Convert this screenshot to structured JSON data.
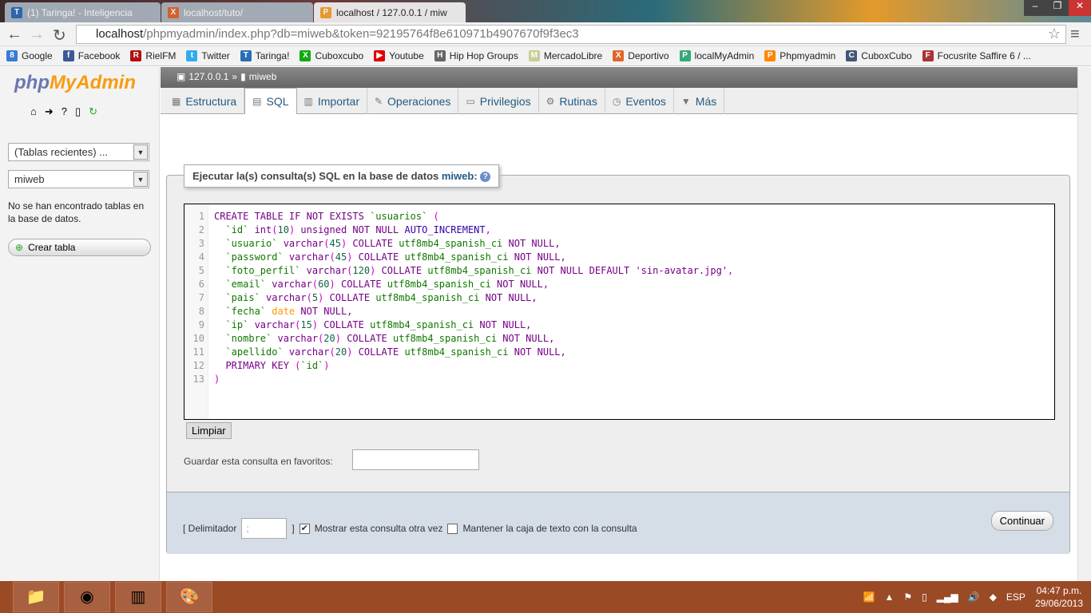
{
  "browser": {
    "tabs": [
      {
        "label": "(1) Taringa! - Inteligencia",
        "icon": "T",
        "color": "#2b6db6"
      },
      {
        "label": "localhost/tuto/",
        "icon": "X",
        "color": "#e0662a"
      },
      {
        "label": "localhost / 127.0.0.1 / miw",
        "icon": "P",
        "color": "#f0a030"
      }
    ],
    "url_host": "localhost",
    "url_path": "/phpmyadmin/index.php?db=miweb&token=92195764f8e610971b4907670f9f3ec3",
    "bookmarks": [
      {
        "label": "Google",
        "icon": "8",
        "color": "#3a7bd5"
      },
      {
        "label": "Facebook",
        "icon": "f",
        "color": "#3b5998"
      },
      {
        "label": "RielFM",
        "icon": "R",
        "color": "#b01010"
      },
      {
        "label": "Twitter",
        "icon": "t",
        "color": "#33aaee"
      },
      {
        "label": "Taringa!",
        "icon": "T",
        "color": "#2b6db6"
      },
      {
        "label": "Cuboxcubo",
        "icon": "X",
        "color": "#1a1"
      },
      {
        "label": "Youtube",
        "icon": "▶",
        "color": "#d00"
      },
      {
        "label": "Hip Hop Groups",
        "icon": "H",
        "color": "#666"
      },
      {
        "label": "MercadoLibre",
        "icon": "M",
        "color": "#cc9"
      },
      {
        "label": "Deportivo",
        "icon": "X",
        "color": "#e0662a"
      },
      {
        "label": "localMyAdmin",
        "icon": "P",
        "color": "#3a7"
      },
      {
        "label": "Phpmyadmin",
        "icon": "P",
        "color": "#f80"
      },
      {
        "label": "CuboxCubo",
        "icon": "C",
        "color": "#457"
      },
      {
        "label": "Focusrite Saffire 6 / ...",
        "icon": "F",
        "color": "#a33"
      }
    ]
  },
  "sidebar": {
    "logo_a": "php",
    "logo_b": "MyAdmin",
    "recent": "(Tablas recientes) ...",
    "db": "miweb",
    "no_tables": "No se han encontrado tablas en la base de datos.",
    "create": "Crear tabla"
  },
  "breadcrumb": {
    "server": "127.0.0.1",
    "sep": "»",
    "db": "miweb"
  },
  "tabs": [
    {
      "label": "Estructura",
      "icon": "▦"
    },
    {
      "label": "SQL",
      "icon": "▤"
    },
    {
      "label": "Importar",
      "icon": "▥"
    },
    {
      "label": "Operaciones",
      "icon": "✎"
    },
    {
      "label": "Privilegios",
      "icon": "▭"
    },
    {
      "label": "Rutinas",
      "icon": "⚙"
    },
    {
      "label": "Eventos",
      "icon": "◷"
    },
    {
      "label": "Más",
      "icon": "▼"
    }
  ],
  "query": {
    "legend": "Ejecutar la(s) consulta(s) SQL en la base de datos",
    "db": "miweb:",
    "lines": [
      [
        [
          "CREATE TABLE IF NOT EXISTS ",
          "kw"
        ],
        [
          "`usuarios`",
          "nm"
        ],
        [
          " (",
          "pn"
        ]
      ],
      [
        [
          "  `id`",
          "nm"
        ],
        [
          " int",
          "df"
        ],
        [
          "(",
          "pn"
        ],
        [
          "10",
          "num"
        ],
        [
          ")",
          "pn"
        ],
        [
          " unsigned NOT NULL ",
          "kw"
        ],
        [
          "AUTO_INCREMENT",
          "fn"
        ],
        [
          ",",
          "pn"
        ]
      ],
      [
        [
          "  `usuario`",
          "nm"
        ],
        [
          " varchar",
          "df"
        ],
        [
          "(",
          "pn"
        ],
        [
          "45",
          "num"
        ],
        [
          ")",
          "pn"
        ],
        [
          " COLLATE ",
          "kw"
        ],
        [
          "utf8mb4_spanish_ci",
          "nm"
        ],
        [
          " NOT NULL,",
          "kw"
        ]
      ],
      [
        [
          "  `password`",
          "nm"
        ],
        [
          " varchar",
          "df"
        ],
        [
          "(",
          "pn"
        ],
        [
          "45",
          "num"
        ],
        [
          ")",
          "pn"
        ],
        [
          " COLLATE ",
          "kw"
        ],
        [
          "utf8mb4_spanish_ci",
          "nm"
        ],
        [
          " NOT NULL,",
          "kw"
        ]
      ],
      [
        [
          "  `foto_perfil`",
          "nm"
        ],
        [
          " varchar",
          "df"
        ],
        [
          "(",
          "pn"
        ],
        [
          "120",
          "num"
        ],
        [
          ")",
          "pn"
        ],
        [
          " COLLATE ",
          "kw"
        ],
        [
          "utf8mb4_spanish_ci",
          "nm"
        ],
        [
          " NOT NULL DEFAULT ",
          "kw"
        ],
        [
          "'sin-avatar.jpg'",
          "df"
        ],
        [
          ",",
          "pn"
        ]
      ],
      [
        [
          "  `email`",
          "nm"
        ],
        [
          " varchar",
          "df"
        ],
        [
          "(",
          "pn"
        ],
        [
          "60",
          "num"
        ],
        [
          ")",
          "pn"
        ],
        [
          " COLLATE ",
          "kw"
        ],
        [
          "utf8mb4_spanish_ci",
          "nm"
        ],
        [
          " NOT NULL,",
          "kw"
        ]
      ],
      [
        [
          "  `pais`",
          "nm"
        ],
        [
          " varchar",
          "df"
        ],
        [
          "(",
          "pn"
        ],
        [
          "5",
          "num"
        ],
        [
          ")",
          "pn"
        ],
        [
          " COLLATE ",
          "kw"
        ],
        [
          "utf8mb4_spanish_ci",
          "nm"
        ],
        [
          " NOT NULL,",
          "kw"
        ]
      ],
      [
        [
          "  `fecha`",
          "nm"
        ],
        [
          " date",
          "ty"
        ],
        [
          " NOT NULL,",
          "kw"
        ]
      ],
      [
        [
          "  `ip`",
          "nm"
        ],
        [
          " varchar",
          "df"
        ],
        [
          "(",
          "pn"
        ],
        [
          "15",
          "num"
        ],
        [
          ")",
          "pn"
        ],
        [
          " COLLATE ",
          "kw"
        ],
        [
          "utf8mb4_spanish_ci",
          "nm"
        ],
        [
          " NOT NULL,",
          "kw"
        ]
      ],
      [
        [
          "  `nombre`",
          "nm"
        ],
        [
          " varchar",
          "df"
        ],
        [
          "(",
          "pn"
        ],
        [
          "20",
          "num"
        ],
        [
          ")",
          "pn"
        ],
        [
          " COLLATE ",
          "kw"
        ],
        [
          "utf8mb4_spanish_ci",
          "nm"
        ],
        [
          " NOT NULL,",
          "kw"
        ]
      ],
      [
        [
          "  `apellido`",
          "nm"
        ],
        [
          " varchar",
          "df"
        ],
        [
          "(",
          "pn"
        ],
        [
          "20",
          "num"
        ],
        [
          ")",
          "pn"
        ],
        [
          " COLLATE ",
          "kw"
        ],
        [
          "utf8mb4_spanish_ci",
          "nm"
        ],
        [
          " NOT NULL,",
          "kw"
        ]
      ],
      [
        [
          "  PRIMARY KEY ",
          "kw"
        ],
        [
          "(",
          "pn"
        ],
        [
          "`id`",
          "nm"
        ],
        [
          ")",
          "pn"
        ]
      ],
      [
        [
          ")",
          "pn"
        ]
      ]
    ],
    "clear": "Limpiar",
    "bookmark_label": "Guardar esta consulta en favoritos:",
    "delim_label": "[ Delimitador",
    "delim_value": ";",
    "delim_close": "]",
    "show_again": "Mostrar esta consulta otra vez",
    "keep_box": "Mantener la caja de texto con la consulta",
    "go": "Continuar"
  },
  "taskbar": {
    "lang": "ESP",
    "time": "04:47 p.m.",
    "date": "29/06/2013"
  }
}
